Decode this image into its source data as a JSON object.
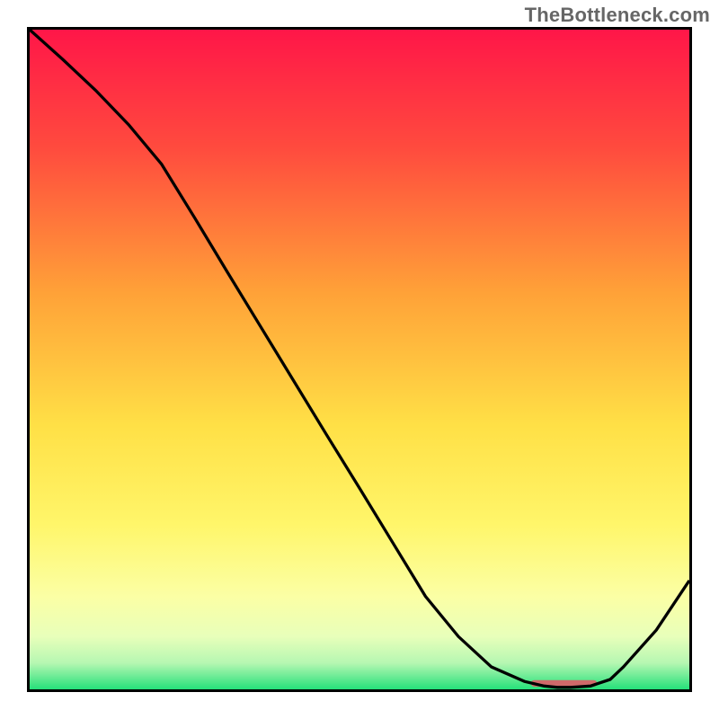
{
  "watermark": "TheBottleneck.com",
  "chart_data": {
    "type": "line",
    "title": "",
    "xlabel": "",
    "ylabel": "",
    "xlim": [
      0,
      100
    ],
    "ylim": [
      0,
      100
    ],
    "x": [
      0,
      5,
      10,
      15,
      20,
      25,
      30,
      35,
      40,
      45,
      50,
      55,
      60,
      65,
      70,
      75,
      78,
      80,
      82,
      85,
      88,
      90,
      95,
      100
    ],
    "values": [
      100,
      95.5,
      90.8,
      85.6,
      79.6,
      71.5,
      63.2,
      55.0,
      46.8,
      38.6,
      30.5,
      22.3,
      14.1,
      8.0,
      3.4,
      1.2,
      0.5,
      0.3,
      0.3,
      0.5,
      1.5,
      3.4,
      9.0,
      16.5
    ],
    "marker": {
      "xStart": 76,
      "xEnd": 86,
      "thickness_pct": 1.0
    },
    "gradient": {
      "stops": [
        {
          "offset": 0,
          "color": "#ff1648"
        },
        {
          "offset": 18,
          "color": "#ff4b3e"
        },
        {
          "offset": 40,
          "color": "#ffa238"
        },
        {
          "offset": 60,
          "color": "#ffe046"
        },
        {
          "offset": 75,
          "color": "#fff66a"
        },
        {
          "offset": 86,
          "color": "#fbffa5"
        },
        {
          "offset": 92,
          "color": "#e8ffba"
        },
        {
          "offset": 96,
          "color": "#b6f7b2"
        },
        {
          "offset": 100,
          "color": "#26e07a"
        }
      ]
    },
    "marker_color": "#cf6a6a",
    "line_color": "#000000"
  }
}
